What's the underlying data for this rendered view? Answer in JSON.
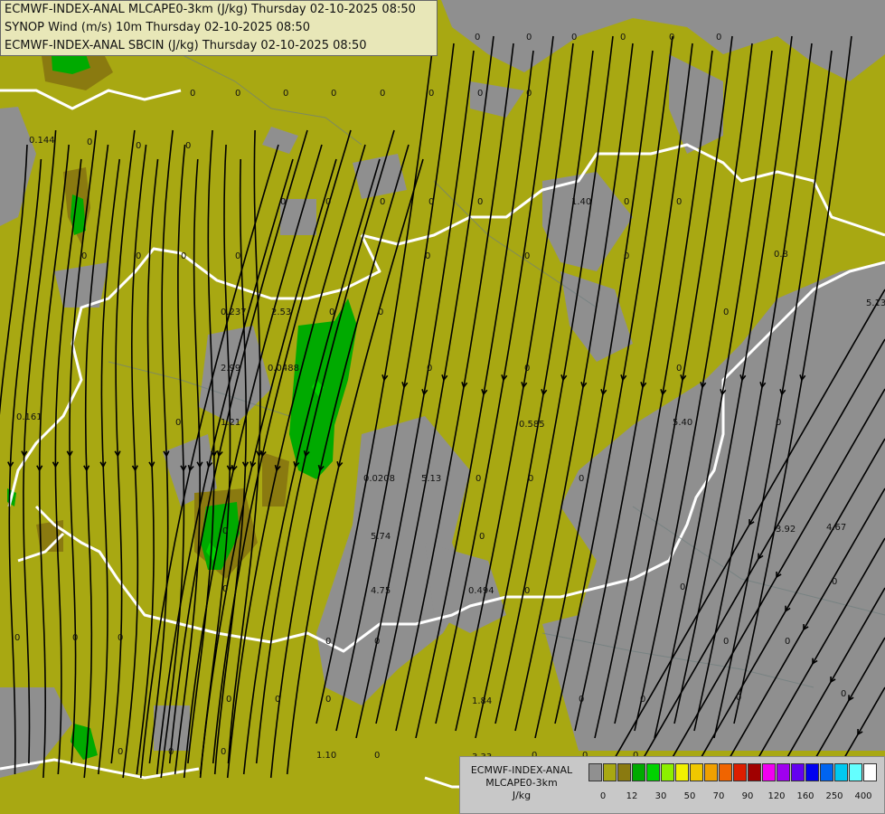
{
  "titles": [
    "ECMWF-INDEX-ANAL MLCAPE0-3km (J/kg) Thursday 02-10-2025 08:50",
    "SYNOP Wind (m/s) 10m Thursday 02-10-2025 08:50",
    "ECMWF-INDEX-ANAL SBCIN (J/kg) Thursday 02-10-2025 08:50"
  ],
  "legend": {
    "title_line1": "ECMWF-INDEX-ANAL",
    "title_line2": "MLCAPE0-3km",
    "unit": "J/kg",
    "colors": [
      "#909090",
      "#a8a812",
      "#8a7a10",
      "#00aa00",
      "#00d200",
      "#8cf000",
      "#f0f000",
      "#f0c800",
      "#f0a000",
      "#f06400",
      "#dc1e00",
      "#a00000",
      "#f000f0",
      "#a000f0",
      "#6400f0",
      "#0000f0",
      "#0064f0",
      "#00c8f0",
      "#64ffff",
      "#ffffff"
    ],
    "ticks": [
      "0",
      "12",
      "30",
      "50",
      "70",
      "90",
      "120",
      "160",
      "250",
      "400"
    ]
  },
  "labels": [
    {
      "t": "0"
    },
    {
      "t": "0"
    },
    {
      "t": "0"
    },
    {
      "t": "0"
    },
    {
      "t": "0"
    },
    {
      "t": "0"
    },
    {
      "t": "0"
    },
    {
      "t": "0"
    },
    {
      "t": "0"
    },
    {
      "t": "0"
    },
    {
      "t": "0.144"
    },
    {
      "t": "0"
    },
    {
      "t": "0"
    },
    {
      "t": "0"
    },
    {
      "t": "0"
    },
    {
      "t": "0"
    },
    {
      "t": "0"
    },
    {
      "t": "0"
    },
    {
      "t": "0"
    },
    {
      "t": "0"
    },
    {
      "t": "0"
    },
    {
      "t": "0"
    },
    {
      "t": "0"
    },
    {
      "t": "1.40"
    },
    {
      "t": "0"
    },
    {
      "t": "0"
    },
    {
      "t": "0"
    },
    {
      "t": "0"
    },
    {
      "t": "0"
    },
    {
      "t": "0"
    },
    {
      "t": "0"
    },
    {
      "t": "0"
    },
    {
      "t": "0"
    },
    {
      "t": "0.8"
    },
    {
      "t": "0.237"
    },
    {
      "t": "2.53"
    },
    {
      "t": "0"
    },
    {
      "t": "0"
    },
    {
      "t": "0"
    },
    {
      "t": "5.13"
    },
    {
      "t": "2.99"
    },
    {
      "t": "0.0488"
    },
    {
      "t": "0"
    },
    {
      "t": "0"
    },
    {
      "t": "0"
    },
    {
      "t": "0.161"
    },
    {
      "t": "1.21"
    },
    {
      "t": "0"
    },
    {
      "t": "0.585"
    },
    {
      "t": "5.40"
    },
    {
      "t": "0"
    },
    {
      "t": "0.0208"
    },
    {
      "t": "5.13"
    },
    {
      "t": "0"
    },
    {
      "t": "0"
    },
    {
      "t": "0"
    },
    {
      "t": "0"
    },
    {
      "t": "5.74"
    },
    {
      "t": "0"
    },
    {
      "t": "3.92"
    },
    {
      "t": "4.67"
    },
    {
      "t": "0"
    },
    {
      "t": "4.75"
    },
    {
      "t": "0.494"
    },
    {
      "t": "0"
    },
    {
      "t": "0"
    },
    {
      "t": "0"
    },
    {
      "t": "0"
    },
    {
      "t": "0"
    },
    {
      "t": "0"
    },
    {
      "t": "0"
    },
    {
      "t": "0"
    },
    {
      "t": "0"
    },
    {
      "t": "0"
    },
    {
      "t": "0"
    },
    {
      "t": "0"
    },
    {
      "t": "0"
    },
    {
      "t": "1.84"
    },
    {
      "t": "0"
    },
    {
      "t": "0"
    },
    {
      "t": "0"
    },
    {
      "t": "0"
    },
    {
      "t": "0"
    },
    {
      "t": "0"
    },
    {
      "t": "0"
    },
    {
      "t": "1.10"
    },
    {
      "t": "0"
    },
    {
      "t": "3.33"
    },
    {
      "t": "0"
    },
    {
      "t": "0"
    },
    {
      "t": "0"
    }
  ]
}
